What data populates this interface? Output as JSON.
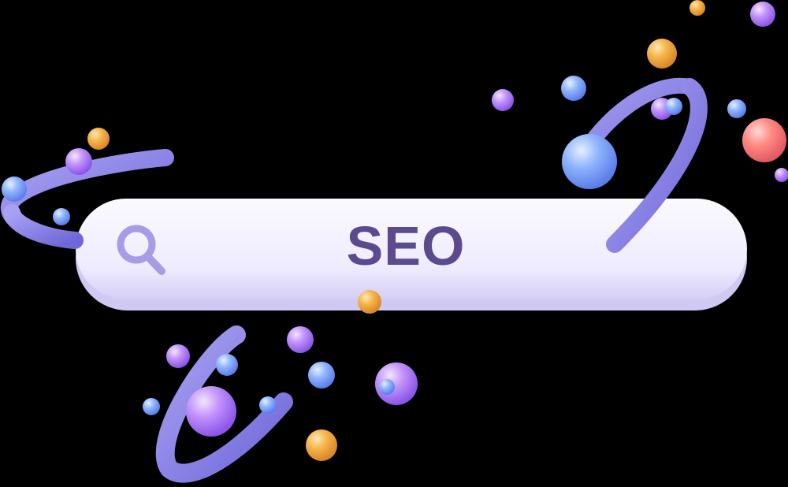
{
  "search_bar": {
    "query": "SEO",
    "icon": "search-icon"
  },
  "colors": {
    "background": "#000000",
    "bar_fill": "#f1efff",
    "bar_shadow": "#cfc9f4",
    "text": "#5b4a8e",
    "icon": "#a89ce6",
    "ring": "#8d86e6",
    "sphere_violet": "#b083f7",
    "sphere_blue": "#7fa8ff",
    "sphere_orange": "#f2a93b",
    "sphere_coral": "#ff7b7b"
  }
}
